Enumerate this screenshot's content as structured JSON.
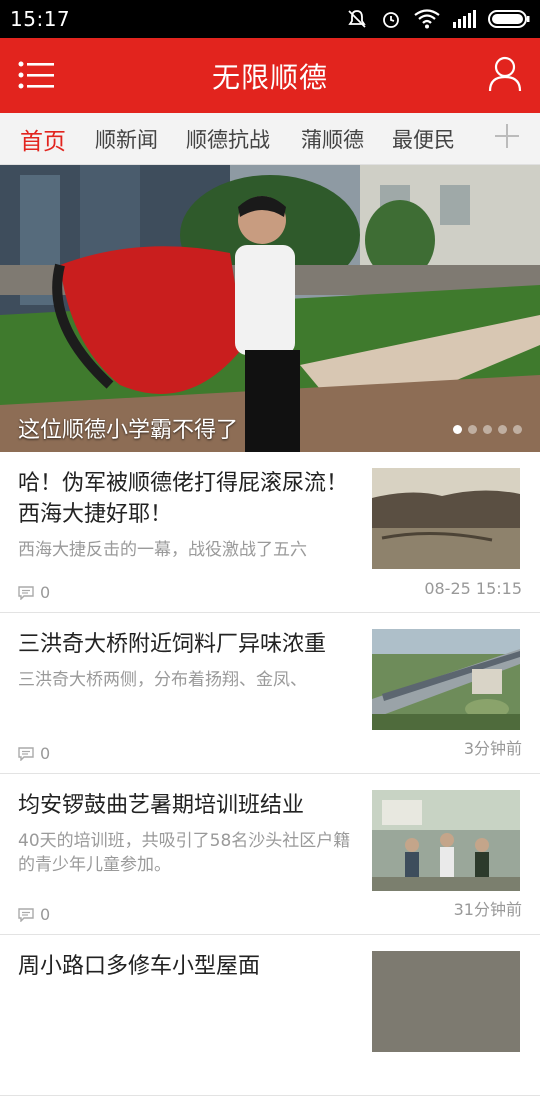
{
  "status": {
    "time": "15:17"
  },
  "header": {
    "title": "无限顺德"
  },
  "tabs": [
    "首页",
    "顺新闻",
    "顺德抗战",
    "蒲顺德",
    "最便民"
  ],
  "banner": {
    "caption": "这位顺德小学霸不得了",
    "slide_count": 5,
    "active_slide": 1
  },
  "articles": [
    {
      "title": "哈！伪军被顺德佬打得屁滚尿流！西海大捷好耶！",
      "summary": "西海大捷反击的一幕，战役激战了五六",
      "comments": "0",
      "time": "08-25 15:15"
    },
    {
      "title": "三洪奇大桥附近饲料厂异味浓重",
      "summary": "三洪奇大桥两侧，分布着扬翔、金凤、",
      "comments": "0",
      "time": "3分钟前"
    },
    {
      "title": "均安锣鼓曲艺暑期培训班结业",
      "summary": "40天的培训班，共吸引了58名沙头社区户籍的青少年儿童参加。",
      "comments": "0",
      "time": "31分钟前"
    },
    {
      "title": "周小路口多修车小型屋面",
      "summary": "",
      "comments": "",
      "time": ""
    }
  ],
  "colors": {
    "accent": "#e2241e",
    "tab_bar": "#f3f3f3"
  }
}
